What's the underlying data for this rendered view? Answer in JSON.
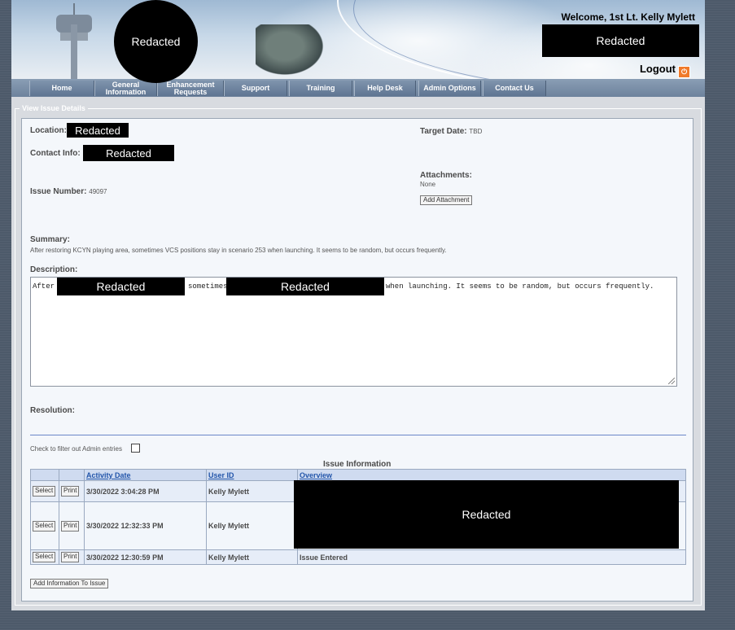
{
  "header": {
    "welcome": "Welcome, 1st Lt. Kelly Mylett",
    "logo_redacted": "Redacted",
    "user_redacted": "Redacted",
    "logout_label": "Logout",
    "logout_icon_glyph": "⏻"
  },
  "nav": {
    "tabs": [
      {
        "label": "Home"
      },
      {
        "label": "General Information"
      },
      {
        "label": "Enhancement Requests"
      },
      {
        "label": "Support"
      },
      {
        "label": "Training"
      },
      {
        "label": "Help Desk"
      },
      {
        "label": "Admin Options"
      },
      {
        "label": "Contact Us"
      }
    ]
  },
  "section": {
    "legend": "View Issue Details"
  },
  "details": {
    "location_label": "Location:",
    "location_value": "Redacted",
    "contact_label": "Contact Info:",
    "contact_value": "Redacted",
    "issue_number_label": "Issue Number:",
    "issue_number_value": "49097",
    "target_date_label": "Target Date:",
    "target_date_value": "TBD",
    "attachments_label": "Attachments:",
    "attachments_value": "None",
    "add_attachment_label": "Add Attachment",
    "summary_label": "Summary:",
    "summary_value": "After restoring KCYN playing area, sometimes VCS positions stay in scenario 253 when launching. It seems to be random, but occurs frequently.",
    "description_label": "Description:",
    "description_part1": "After",
    "description_redact1": "Redacted",
    "description_part2": "sometimes",
    "description_redact2": "Redacted",
    "description_part3": "when launching. It seems to be random, but occurs frequently.",
    "resolution_label": "Resolution:"
  },
  "filter": {
    "label": "Check to filter out Admin entries"
  },
  "table": {
    "caption": "Issue Information",
    "headers": [
      "Activity Date",
      "User ID",
      "Overview"
    ],
    "select_label": "Select",
    "print_label": "Print",
    "rows": [
      {
        "date": "3/30/2022 3:04:28 PM",
        "user": "Kelly Mylett",
        "overview": ""
      },
      {
        "date": "3/30/2022 12:32:33 PM",
        "user": "Kelly Mylett",
        "overview": ""
      },
      {
        "date": "3/30/2022 12:30:59 PM",
        "user": "Kelly Mylett",
        "overview": "Issue Entered"
      }
    ],
    "overview_redacted": "Redacted"
  },
  "footer": {
    "add_info_label": "Add Information To Issue"
  }
}
